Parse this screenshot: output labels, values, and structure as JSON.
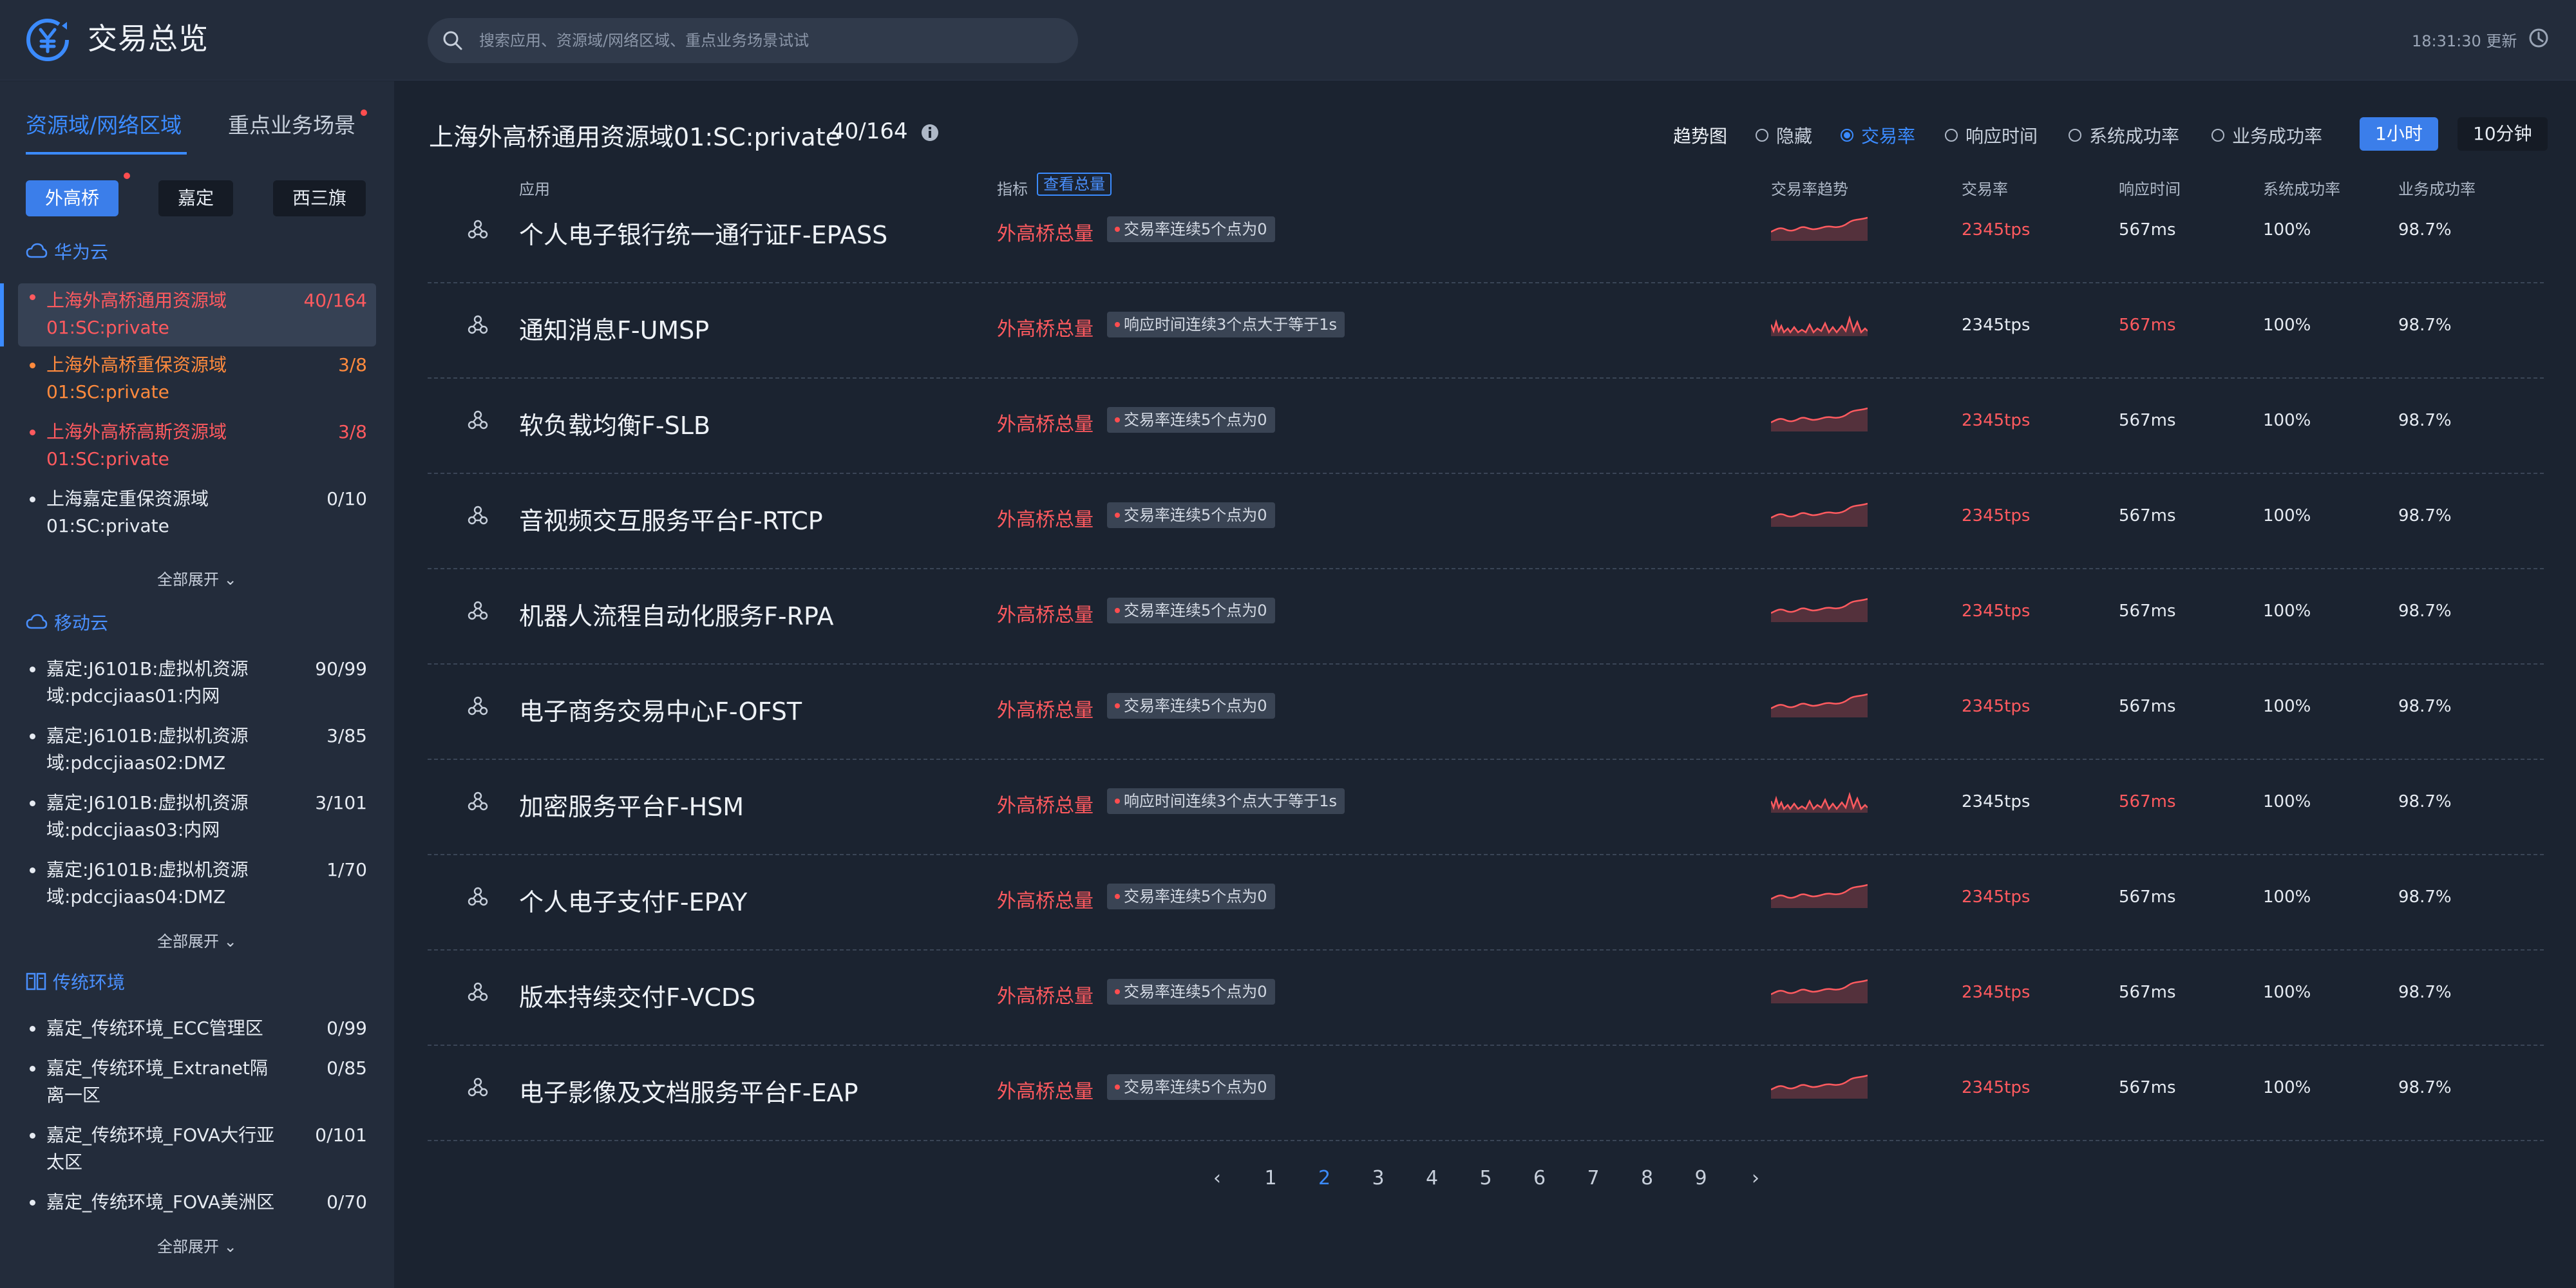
{
  "header": {
    "title": "交易总览",
    "search_placeholder": "搜索应用、资源域/网络区域、重点业务场景试试",
    "update_time": "18:31:30 更新"
  },
  "sidebar": {
    "tabs": [
      "资源域/网络区域",
      "重点业务场景"
    ],
    "chips": [
      "外高桥",
      "嘉定",
      "西三旗"
    ],
    "expand_label": "全部展开",
    "groups": [
      {
        "name": "华为云",
        "items": [
          {
            "name": "上海外高桥通用资源域01:SC:private",
            "count": "40/164"
          },
          {
            "name": "上海外高桥重保资源域01:SC:private",
            "count": "3/8"
          },
          {
            "name": "上海外高桥高斯资源域01:SC:private",
            "count": "3/8"
          },
          {
            "name": "上海嘉定重保资源域01:SC:private",
            "count": "0/10"
          }
        ]
      },
      {
        "name": "移动云",
        "items": [
          {
            "name": "嘉定:J6101B:虚拟机资源域:pdccjiaas01:内网",
            "count": "90/99"
          },
          {
            "name": "嘉定:J6101B:虚拟机资源域:pdccjiaas02:DMZ",
            "count": "3/85"
          },
          {
            "name": "嘉定:J6101B:虚拟机资源域:pdccjiaas03:内网",
            "count": "3/101"
          },
          {
            "name": "嘉定:J6101B:虚拟机资源域:pdccjiaas04:DMZ",
            "count": "1/70"
          }
        ]
      },
      {
        "name": "传统环境",
        "items": [
          {
            "name": "嘉定_传统环境_ECC管理区",
            "count": "0/99"
          },
          {
            "name": "嘉定_传统环境_Extranet隔离一区",
            "count": "0/85"
          },
          {
            "name": "嘉定_传统环境_FOVA大行亚太区",
            "count": "0/101"
          },
          {
            "name": "嘉定_传统环境_FOVA美洲区",
            "count": "0/70"
          }
        ]
      }
    ]
  },
  "main": {
    "title": "上海外高桥通用资源域01:SC:private",
    "count": "40/164",
    "trend_label": "趋势图",
    "trend_options": [
      "隐藏",
      "交易率",
      "响应时间",
      "系统成功率",
      "业务成功率"
    ],
    "time_buttons": [
      "1小时",
      "10分钟"
    ],
    "columns": {
      "app": "应用",
      "metric": "指标",
      "view_total": "查看总量",
      "trend": "交易率趋势",
      "rate": "交易率",
      "response": "响应时间",
      "sys_success": "系统成功率",
      "biz_success": "业务成功率"
    },
    "rows": [
      {
        "app": "个人电子银行统一通行证F-EPASS",
        "metric": "外高桥总量",
        "alert": "交易率连续5个点为0",
        "rate": "2345tps",
        "response": "567ms",
        "sys": "100%",
        "biz": "98.7%",
        "highlight": "rate"
      },
      {
        "app": "通知消息F-UMSP",
        "metric": "外高桥总量",
        "alert": "响应时间连续3个点大于等于1s",
        "rate": "2345tps",
        "response": "567ms",
        "sys": "100%",
        "biz": "98.7%",
        "highlight": "response"
      },
      {
        "app": "软负载均衡F-SLB",
        "metric": "外高桥总量",
        "alert": "交易率连续5个点为0",
        "rate": "2345tps",
        "response": "567ms",
        "sys": "100%",
        "biz": "98.7%",
        "highlight": "rate"
      },
      {
        "app": "音视频交互服务平台F-RTCP",
        "metric": "外高桥总量",
        "alert": "交易率连续5个点为0",
        "rate": "2345tps",
        "response": "567ms",
        "sys": "100%",
        "biz": "98.7%",
        "highlight": "rate"
      },
      {
        "app": "机器人流程自动化服务F-RPA",
        "metric": "外高桥总量",
        "alert": "交易率连续5个点为0",
        "rate": "2345tps",
        "response": "567ms",
        "sys": "100%",
        "biz": "98.7%",
        "highlight": "rate"
      },
      {
        "app": "电子商务交易中心F-OFST",
        "metric": "外高桥总量",
        "alert": "交易率连续5个点为0",
        "rate": "2345tps",
        "response": "567ms",
        "sys": "100%",
        "biz": "98.7%",
        "highlight": "rate"
      },
      {
        "app": "加密服务平台F-HSM",
        "metric": "外高桥总量",
        "alert": "响应时间连续3个点大于等于1s",
        "rate": "2345tps",
        "response": "567ms",
        "sys": "100%",
        "biz": "98.7%",
        "highlight": "response"
      },
      {
        "app": "个人电子支付F-EPAY",
        "metric": "外高桥总量",
        "alert": "交易率连续5个点为0",
        "rate": "2345tps",
        "response": "567ms",
        "sys": "100%",
        "biz": "98.7%",
        "highlight": "rate"
      },
      {
        "app": "版本持续交付F-VCDS",
        "metric": "外高桥总量",
        "alert": "交易率连续5个点为0",
        "rate": "2345tps",
        "response": "567ms",
        "sys": "100%",
        "biz": "98.7%",
        "highlight": "rate"
      },
      {
        "app": "电子影像及文档服务平台F-EAP",
        "metric": "外高桥总量",
        "alert": "交易率连续5个点为0",
        "rate": "2345tps",
        "response": "567ms",
        "sys": "100%",
        "biz": "98.7%",
        "highlight": "rate"
      }
    ],
    "pagination": {
      "pages": [
        "1",
        "2",
        "3",
        "4",
        "5",
        "6",
        "7",
        "8",
        "9"
      ],
      "current": "2"
    }
  },
  "colors": {
    "accent": "#3b8bff",
    "alert_red": "#ff5a5f",
    "warn_orange": "#ff8a3d",
    "bg": "#1b2330",
    "panel": "#232c3b"
  }
}
